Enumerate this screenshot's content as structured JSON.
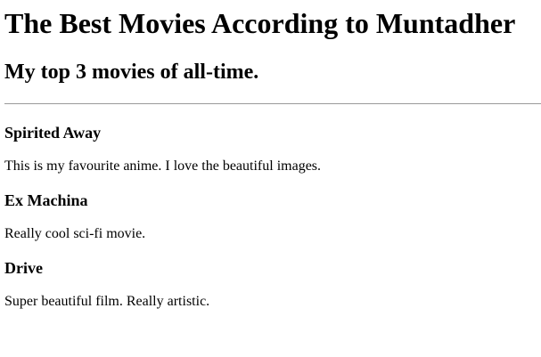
{
  "page": {
    "title": "The Best Movies According to Muntadher",
    "subtitle": "My top 3 movies of all-time."
  },
  "movies": [
    {
      "title": "Spirited Away",
      "description": "This is my favourite anime. I love the beautiful images."
    },
    {
      "title": "Ex Machina",
      "description": "Really cool sci-fi movie."
    },
    {
      "title": "Drive",
      "description": "Super beautiful film. Really artistic."
    }
  ]
}
